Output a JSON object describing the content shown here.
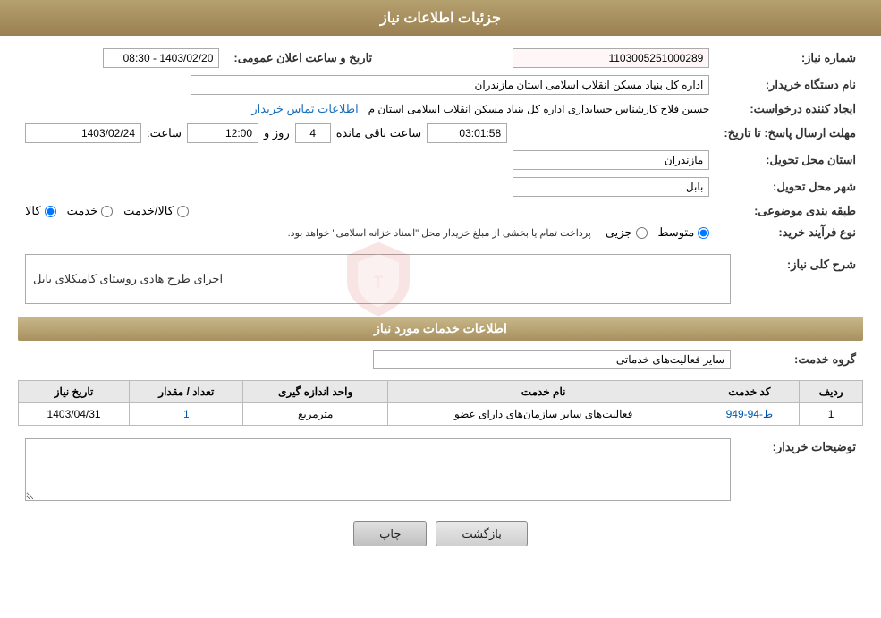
{
  "header": {
    "title": "جزئیات اطلاعات نیاز"
  },
  "fields": {
    "request_number_label": "شماره نیاز:",
    "request_number_value": "1103005251000289",
    "buyer_org_label": "نام دستگاه خریدار:",
    "buyer_org_value": "اداره کل بنیاد مسکن انقلاب اسلامی استان مازندران",
    "announcement_label": "تاریخ و ساعت اعلان عمومی:",
    "announcement_date": "1403/02/20 - 08:30",
    "creator_label": "ایجاد کننده درخواست:",
    "creator_contact_label": "اطلاعات تماس خریدار",
    "creator_name": "حسین فلاح کارشناس حسابداری اداره کل بنیاد مسکن انقلاب اسلامی استان م",
    "response_deadline_label": "مهلت ارسال پاسخ: تا تاریخ:",
    "response_date": "1403/02/24",
    "response_time_label": "ساعت:",
    "response_time": "12:00",
    "days_label": "روز و",
    "days_value": "4",
    "countdown_label": "ساعت باقی مانده",
    "countdown_value": "03:01:58",
    "province_label": "استان محل تحویل:",
    "province_value": "مازندران",
    "city_label": "شهر محل تحویل:",
    "city_value": "بابل",
    "category_label": "طبقه بندی موضوعی:",
    "category_options": [
      "کالا",
      "خدمت",
      "کالا/خدمت"
    ],
    "category_selected": "کالا",
    "process_label": "نوع فرآیند خرید:",
    "process_options": [
      "جزیی",
      "متوسط"
    ],
    "process_note": "پرداخت تمام یا بخشی از مبلغ خریدار محل \"اسناد خزانه اسلامی\" خواهد بود.",
    "description_label": "شرح کلی نیاز:",
    "description_value": "اجرای طرح هادی روستای کامیکلای بابل",
    "services_section_title": "اطلاعات خدمات مورد نیاز",
    "service_group_label": "گروه خدمت:",
    "service_group_value": "سایر فعالیت‌های خدماتی",
    "table_headers": [
      "ردیف",
      "کد خدمت",
      "نام خدمت",
      "واحد اندازه گیری",
      "تعداد / مقدار",
      "تاریخ نیاز"
    ],
    "table_rows": [
      {
        "row": "1",
        "code": "ط-94-949",
        "name": "فعالیت‌های سایر سازمان‌های دارای عضو",
        "unit": "مترمربع",
        "count": "1",
        "date": "1403/04/31"
      }
    ],
    "buyer_desc_label": "توضیحات خریدار:",
    "buyer_desc_value": "",
    "btn_print": "چاپ",
    "btn_back": "بازگشت"
  }
}
